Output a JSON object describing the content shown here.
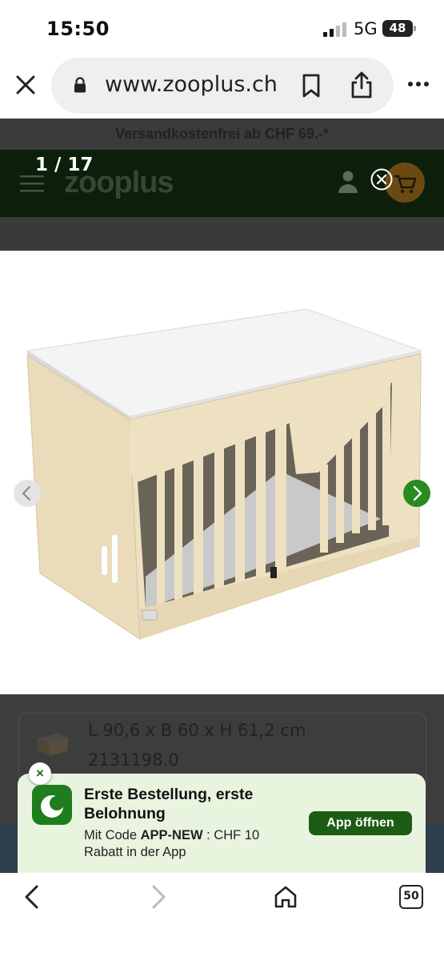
{
  "status_bar": {
    "time": "15:50",
    "network": "5G",
    "battery": "48"
  },
  "browser": {
    "url": "www.zooplus.ch",
    "tab_count": "50"
  },
  "page": {
    "promo_text": "Versandkostenfrei ab CHF 69.-*",
    "logo": "zooplus"
  },
  "gallery": {
    "counter": "1 / 17"
  },
  "product": {
    "dimensions": "L 90,6 x B 60 x H 61,2 cm",
    "article_number": "2131198.0"
  },
  "app_banner": {
    "title": "Erste Bestellung, erste Belohnung",
    "text_prefix": "Mit Code ",
    "code": "APP-NEW",
    "text_suffix": " : CHF 10 Rabatt in der App",
    "button_label": "App öffnen",
    "close_glyph": "×"
  },
  "colors": {
    "brand_green": "#1d5c14",
    "next_arrow": "#2a8a1f",
    "banner_bg": "#e9f4df"
  }
}
